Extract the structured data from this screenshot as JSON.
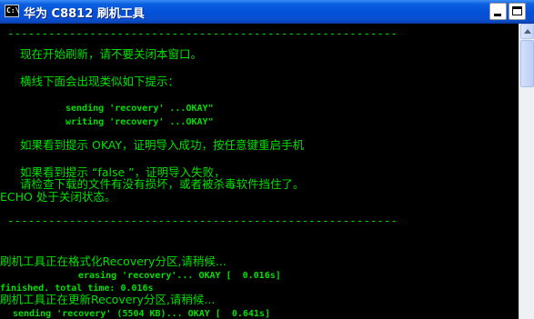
{
  "window": {
    "title": "华为 C8812 刷机工具",
    "icon_text": "C:\\",
    "buttons": {
      "minimize": "minimize-icon",
      "maximize": "maximize-icon"
    }
  },
  "console": {
    "separator_top": "---------------------------------------------------------",
    "line_start": "现在开始刷新，请不要关闭本窗口。",
    "line_hint": "横线下面会出现类似如下提示：",
    "line_sending": "sending 'recovery' ...OKAY\"",
    "line_writing": "writing 'recovery' ...OKAY\"",
    "line_ok": "如果看到提示 OKAY，证明导入成功，按任意键重启手机",
    "line_false": "如果看到提示 “false ”，证明导入失败，",
    "line_check": "请检查下载的文件有没有损坏，或者被杀毒软件挡住了。",
    "line_echo": "ECHO 处于关闭状态。",
    "separator_bottom": "---------------------------------------------------------",
    "line_format": "刷机工具正在格式化Recovery分区,请稍候...",
    "line_erasing": "erasing 'recovery'... OKAY [  0.016s]",
    "line_finished": "finished. total time: 0.016s",
    "line_update": "刷机工具正在更新Recovery分区,请稍候...",
    "line_sending2": "sending 'recovery' (5504 KB)... OKAY [  0.641s]"
  },
  "colors": {
    "text_green": "#00e000",
    "background": "#000000",
    "titlebar_blue": "#0550d8"
  }
}
